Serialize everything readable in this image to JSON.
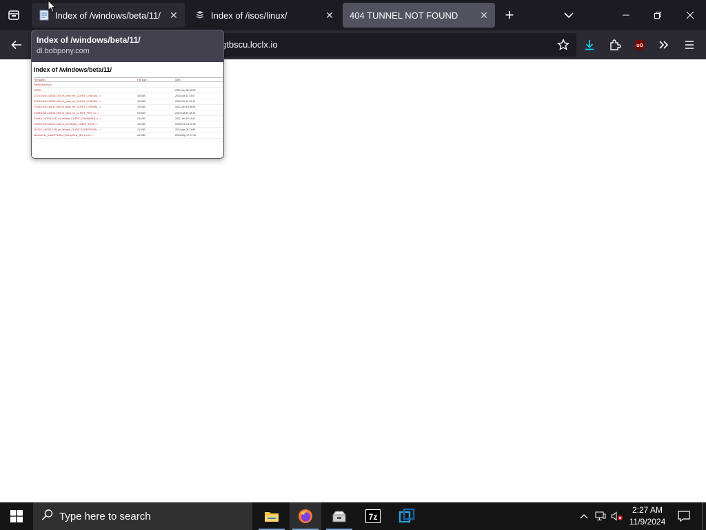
{
  "browser": {
    "tabs": [
      {
        "title": "Index of /windows/beta/11/",
        "state": "hover"
      },
      {
        "title": "Index of /isos/linux/",
        "state": "normal"
      },
      {
        "title": "404 TUNNEL NOT FOUND",
        "state": "active"
      }
    ],
    "url": {
      "dim_prefix": "",
      "host": "gtbscu.loclx.io"
    }
  },
  "tab_preview": {
    "title": "Index of /windows/beta/11/",
    "domain": "dl.bobpony.com",
    "thumbnail": {
      "heading": "Index of /windows/beta/11/",
      "columns": [
        "File Name ↓",
        "File Size ↓",
        "Date ↓"
      ],
      "rows": [
        [
          "Parent directory/",
          "-",
          "-"
        ],
        [
          "22000/",
          "-",
          "2021-Jun-05 00:50"
        ],
        [
          "21370.1000.210516-1700.fe_prodr_fre_CLIENT_CONSUM...>",
          "4.5 GiB",
          "2024-Oct-21 15:07"
        ],
        [
          "21376.1000.210526-1900.fe_prodr_fre_CLIENT_CONSUM...>",
          "4.5 GiB",
          "2024-Oct-22 18:12"
        ],
        [
          "21380.1003.210611-1900.fe_dlook_fre_CLIENT_CONSUM...>",
          "4.9 GiB",
          "2022-Jun-18 06:53"
        ],
        [
          "21385.1002.210619-1900.fe_dlook_fre_CLIENT_PRO_vo...>",
          "5.9 GiB",
          "2024-Oct-22 18:19"
        ],
        [
          "21996.1.210529-1541.co_release_CLIENT_CONSUMER_x...>",
          "4.5 GiB",
          "2021-Jun-15 15:41"
        ],
        [
          "22000.1000.220421-1312.ni_prerelease_CLIENT_ENTE...>",
          "4.5 GiB",
          "2024-Feb-01 02:02"
        ],
        [
          "26100.1.240331-1435.ge_release_CLIENT_ENTERPRISE_...>",
          "4.2 GiB",
          "2024-Apr-04 13:50"
        ],
        [
          "Windows11_InsiderPreview_Enterprisevl_x64_en-us...>",
          "4.2 GiB",
          "2024-Sep-17 21:16"
        ]
      ]
    }
  },
  "taskbar": {
    "search_placeholder": "Type here to search",
    "time": "2:27 AM",
    "date": "11/9/2024",
    "apps": [
      "file-explorer",
      "firefox",
      "app-installer",
      "7-zip",
      "virtualbox"
    ]
  },
  "colors": {
    "tabstrip": "#1c1b22",
    "navbar": "#2b2a33",
    "taskbar": "#151515",
    "download_accent": "#0df",
    "ublock_red": "#800000"
  }
}
